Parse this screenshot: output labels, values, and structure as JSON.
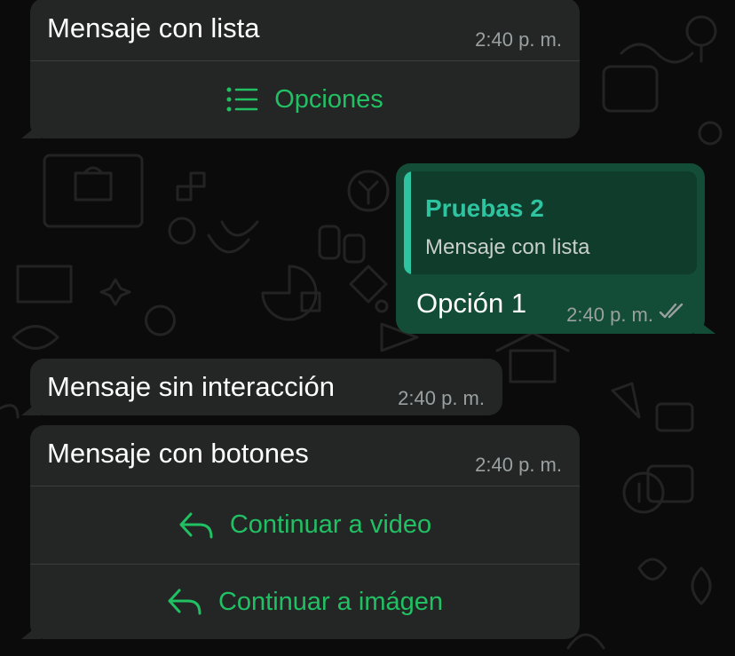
{
  "chat": {
    "messages": [
      {
        "id": "list-message",
        "direction": "incoming",
        "text": "Mensaje con lista",
        "time": "2:40 p. m.",
        "action_label": "Opciones",
        "action_icon": "list-icon"
      },
      {
        "id": "reply-message",
        "direction": "outgoing",
        "quoted_author": "Pruebas 2",
        "quoted_text": "Mensaje con lista",
        "text": "Opción 1",
        "time": "2:40 p. m.",
        "status_icon": "double-check-icon"
      },
      {
        "id": "plain-message",
        "direction": "incoming",
        "text": "Mensaje sin interacción",
        "time": "2:40 p. m."
      },
      {
        "id": "buttons-message",
        "direction": "incoming",
        "text": "Mensaje con botones",
        "time": "2:40 p. m.",
        "buttons": [
          {
            "label": "Continuar a video",
            "icon": "reply-icon"
          },
          {
            "label": "Continuar a imágen",
            "icon": "reply-icon"
          }
        ]
      }
    ]
  },
  "colors": {
    "background": "#0b0b0b",
    "incoming_bubble": "#242626",
    "outgoing_bubble": "#144d37",
    "accent_green": "#21c063",
    "quote_accent": "#2ec4a0",
    "timestamp": "#9aa0a0"
  }
}
